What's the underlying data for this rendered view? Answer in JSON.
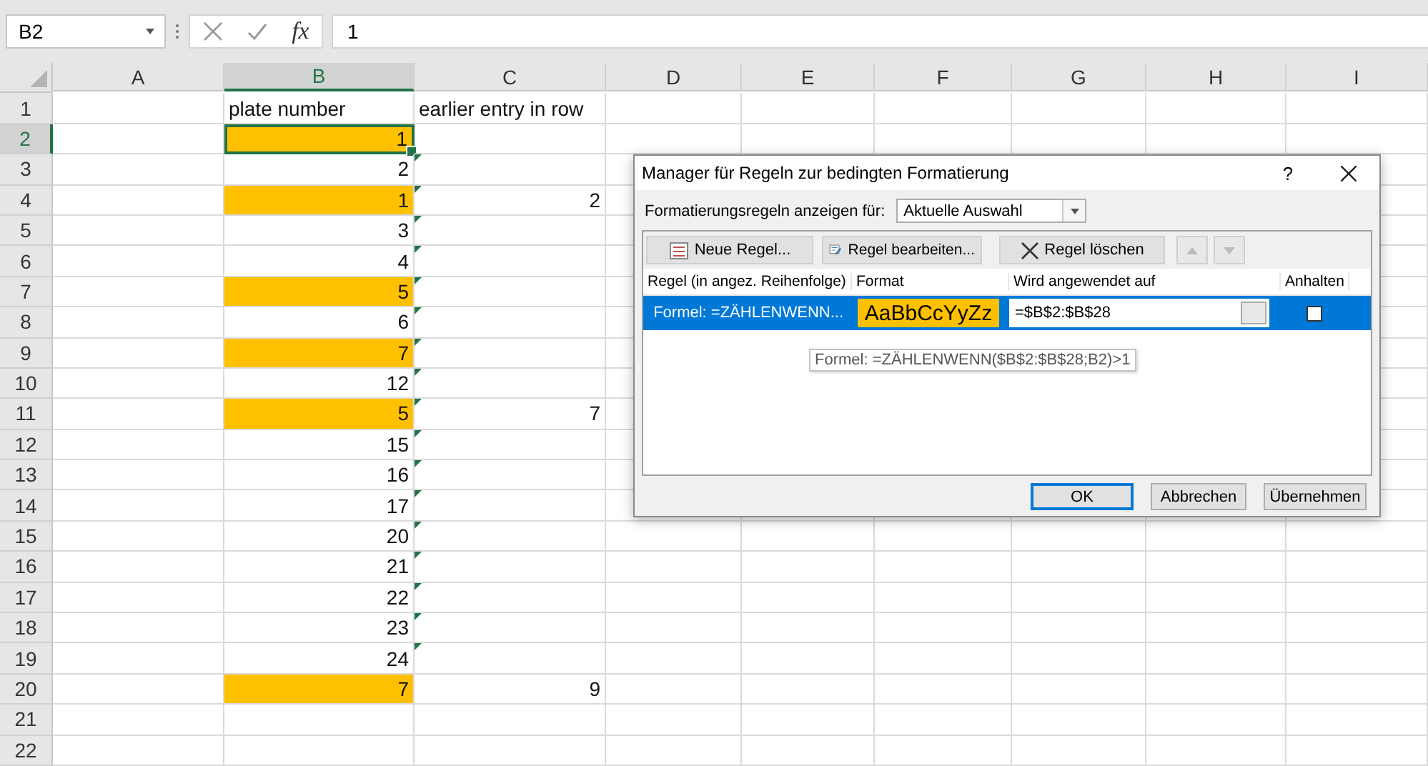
{
  "formula_bar": {
    "name_box": "B2",
    "function_label": "fx",
    "formula": "1"
  },
  "columns": [
    {
      "label": "A",
      "selected": false
    },
    {
      "label": "B",
      "selected": true
    },
    {
      "label": "C",
      "selected": false
    },
    {
      "label": "D",
      "selected": false
    },
    {
      "label": "E",
      "selected": false
    },
    {
      "label": "F",
      "selected": false
    },
    {
      "label": "G",
      "selected": false
    },
    {
      "label": "H",
      "selected": false
    },
    {
      "label": "I",
      "selected": false
    }
  ],
  "rows": [
    {
      "label": "1",
      "selected": false,
      "kind": "text",
      "b": "plate number",
      "c": "earlier entry in row",
      "highlighted": false,
      "c_indicator": false
    },
    {
      "label": "2",
      "selected": true,
      "kind": "number",
      "b": "1",
      "highlighted": true,
      "c_indicator": false
    },
    {
      "label": "3",
      "selected": false,
      "kind": "number",
      "b": "2",
      "highlighted": false,
      "c_indicator": true
    },
    {
      "label": "4",
      "selected": false,
      "kind": "number",
      "b": "1",
      "c": "2",
      "highlighted": true,
      "c_indicator": true
    },
    {
      "label": "5",
      "selected": false,
      "kind": "number",
      "b": "3",
      "highlighted": false,
      "c_indicator": true
    },
    {
      "label": "6",
      "selected": false,
      "kind": "number",
      "b": "4",
      "highlighted": false,
      "c_indicator": true
    },
    {
      "label": "7",
      "selected": false,
      "kind": "number",
      "b": "5",
      "highlighted": true,
      "c_indicator": true
    },
    {
      "label": "8",
      "selected": false,
      "kind": "number",
      "b": "6",
      "highlighted": false,
      "c_indicator": true
    },
    {
      "label": "9",
      "selected": false,
      "kind": "number",
      "b": "7",
      "highlighted": true,
      "c_indicator": true
    },
    {
      "label": "10",
      "selected": false,
      "kind": "number",
      "b": "12",
      "highlighted": false,
      "c_indicator": true
    },
    {
      "label": "11",
      "selected": false,
      "kind": "number",
      "b": "5",
      "c": "7",
      "highlighted": true,
      "c_indicator": true
    },
    {
      "label": "12",
      "selected": false,
      "kind": "number",
      "b": "15",
      "highlighted": false,
      "c_indicator": true
    },
    {
      "label": "13",
      "selected": false,
      "kind": "number",
      "b": "16",
      "highlighted": false,
      "c_indicator": true
    },
    {
      "label": "14",
      "selected": false,
      "kind": "number",
      "b": "17",
      "highlighted": false,
      "c_indicator": true
    },
    {
      "label": "15",
      "selected": false,
      "kind": "number",
      "b": "20",
      "highlighted": false,
      "c_indicator": true
    },
    {
      "label": "16",
      "selected": false,
      "kind": "number",
      "b": "21",
      "highlighted": false,
      "c_indicator": true
    },
    {
      "label": "17",
      "selected": false,
      "kind": "number",
      "b": "22",
      "highlighted": false,
      "c_indicator": true
    },
    {
      "label": "18",
      "selected": false,
      "kind": "number",
      "b": "23",
      "highlighted": false,
      "c_indicator": true
    },
    {
      "label": "19",
      "selected": false,
      "kind": "number",
      "b": "24",
      "highlighted": false,
      "c_indicator": true
    },
    {
      "label": "20",
      "selected": false,
      "kind": "number",
      "b": "7",
      "c": "9",
      "highlighted": true,
      "c_indicator": false
    },
    {
      "label": "21",
      "selected": false,
      "kind": "number",
      "highlighted": false,
      "c_indicator": false
    },
    {
      "label": "22",
      "selected": false,
      "kind": "number",
      "highlighted": false,
      "c_indicator": false
    }
  ],
  "dialog": {
    "title": "Manager für Regeln zur bedingten Formatierung",
    "help": "?",
    "show_for_label": "Formatierungsregeln anzeigen für:",
    "show_for_value": "Aktuelle Auswahl",
    "toolbar": [
      {
        "label": "Neue Regel...",
        "kind": "new"
      },
      {
        "label": "Regel bearbeiten...",
        "kind": "edit"
      },
      {
        "label": "Regel löschen",
        "kind": "delete"
      }
    ],
    "move_buttons": [
      {
        "kind": "up",
        "disabled": true
      },
      {
        "kind": "down",
        "disabled": true
      }
    ],
    "columns": [
      "Regel (in angez. Reihenfolge)",
      "Format",
      "Wird angewendet auf",
      "Anhalten"
    ],
    "rules": [
      {
        "rule": "Formel: =ZÄHLENWENN...",
        "preview": "AaBbCcYyZz",
        "applies_to": "=$B$2:$B$28",
        "stop": false,
        "selected": true
      }
    ],
    "tooltip": "Formel: =ZÄHLENWENN($B$2:$B$28;B2)>1",
    "buttons": [
      {
        "label": "OK",
        "default": true
      },
      {
        "label": "Abbrechen",
        "default": false
      },
      {
        "label": "Übernehmen",
        "default": false
      }
    ]
  }
}
